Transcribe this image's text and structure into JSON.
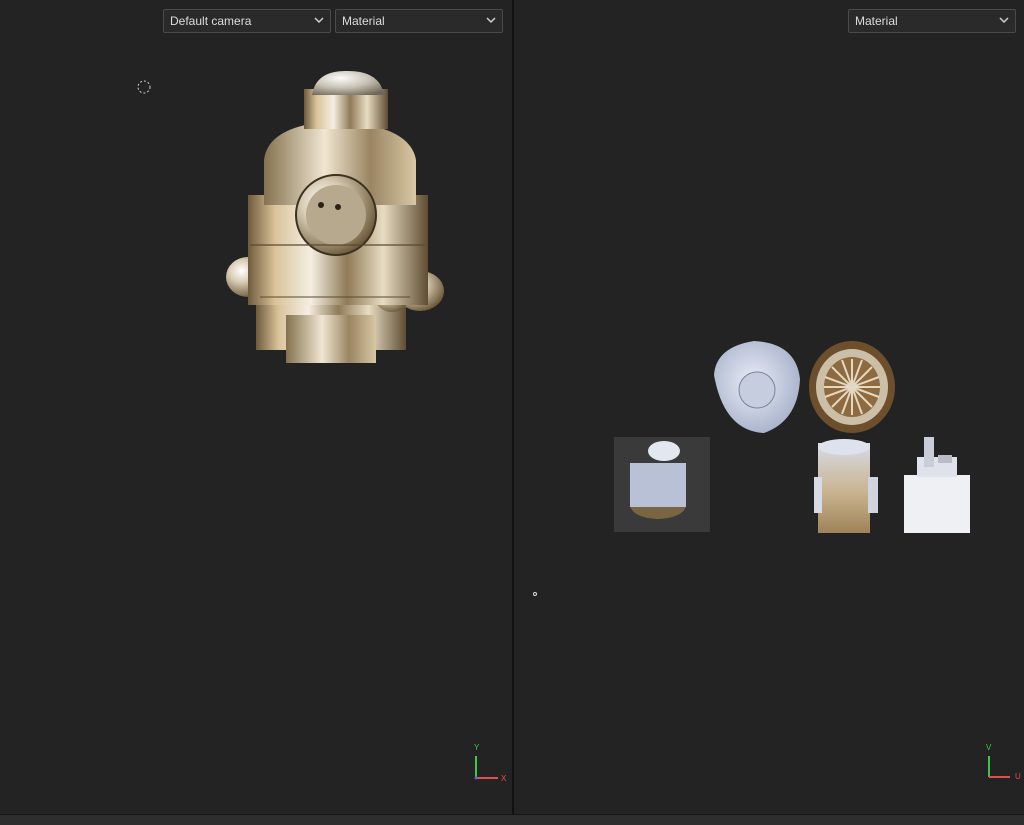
{
  "left_viewport": {
    "camera_select": "Default camera",
    "material_select": "Material",
    "axis_labels": {
      "vertical": "Y",
      "horizontal": "X"
    },
    "axis_colors": {
      "vertical": "#3ec84b",
      "horizontal": "#e05050"
    }
  },
  "right_viewport": {
    "material_select": "Material",
    "axis_labels": {
      "vertical": "V",
      "horizontal": "U"
    },
    "axis_colors": {
      "vertical": "#3ec84b",
      "horizontal": "#e05050"
    }
  },
  "icons": {
    "dropdown": "chevron-down-icon",
    "orbit_pivot": "dashed-circle-icon"
  }
}
